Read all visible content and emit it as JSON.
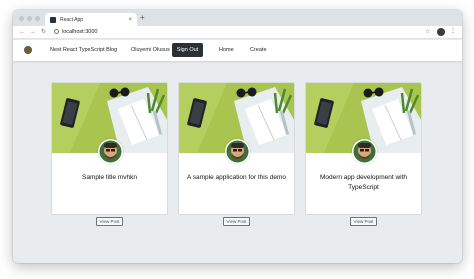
{
  "browser": {
    "tab_title": "React App",
    "tab_close": "×",
    "new_tab": "+",
    "url": "localhost:3000",
    "nav_back": "←",
    "nav_forward": "→",
    "nav_reload": "↻",
    "star": "☆",
    "menu": "⋮"
  },
  "navbar": {
    "brand": "Nest React TypeScript Blog",
    "user_name": "Oluyemi Olusus",
    "sign_out": "Sign Out",
    "home": "Home",
    "create": "Create"
  },
  "posts": [
    {
      "title": "Sample title mvhkn",
      "button": "View Post"
    },
    {
      "title": "A sample application for this demo",
      "button": "View Post"
    },
    {
      "title": "Modern app development with TypeScript",
      "button": "View Post"
    }
  ],
  "colors": {
    "signout_bg": "#2b3035",
    "image_green": "#a9c54f",
    "page_bg": "#e9ecef"
  }
}
